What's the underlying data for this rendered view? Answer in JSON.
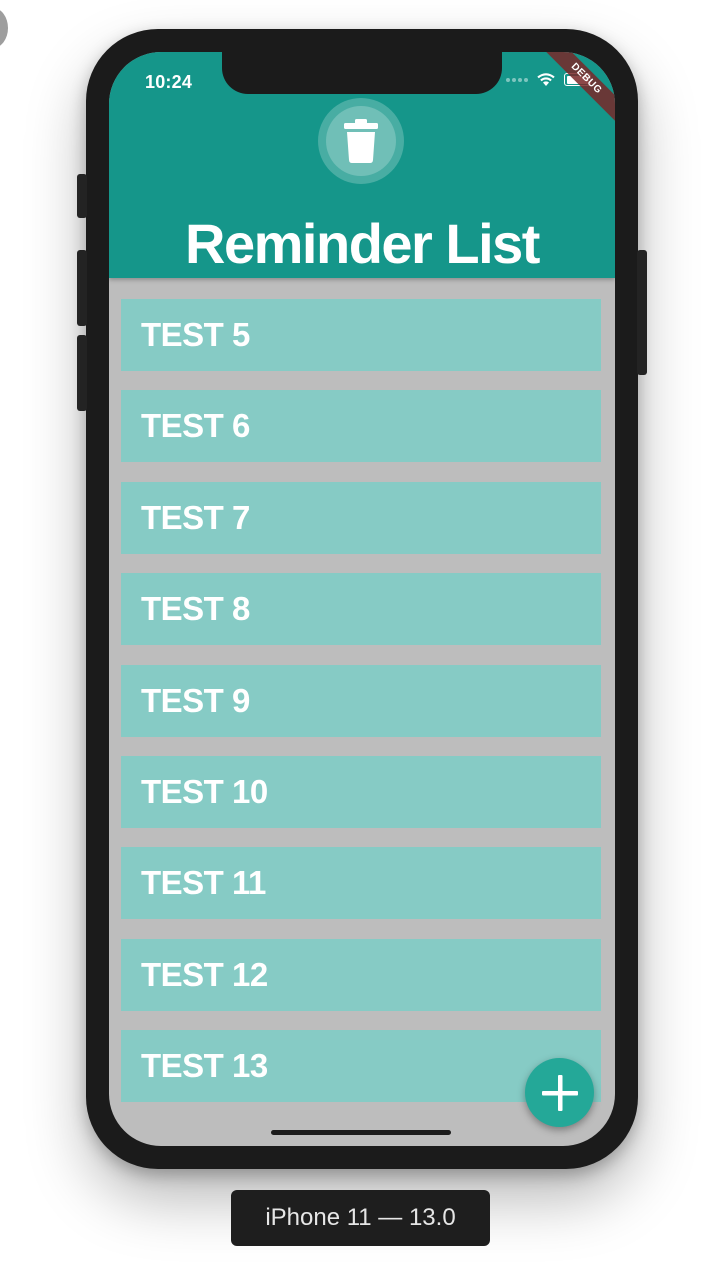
{
  "status_bar": {
    "time": "10:24",
    "icons": [
      "signal-dots-icon",
      "wifi-icon",
      "battery-icon"
    ],
    "battery_level": 1.0
  },
  "debug_banner": "DEBUG",
  "header": {
    "title": "Reminder List",
    "action_icon": "trash-icon"
  },
  "reminders": [
    {
      "label": "TEST 5"
    },
    {
      "label": "TEST 6"
    },
    {
      "label": "TEST 7"
    },
    {
      "label": "TEST 8"
    },
    {
      "label": "TEST 9"
    },
    {
      "label": "TEST 10"
    },
    {
      "label": "TEST 11"
    },
    {
      "label": "TEST 12"
    },
    {
      "label": "TEST 13"
    }
  ],
  "fab": {
    "icon": "plus-icon"
  },
  "device_label": "iPhone 11 — 13.0",
  "colors": {
    "header": "#15968a",
    "list_item": "#86cbc5",
    "list_background": "#bdbdbd",
    "fab": "#24a898",
    "text": "#ffffff"
  }
}
